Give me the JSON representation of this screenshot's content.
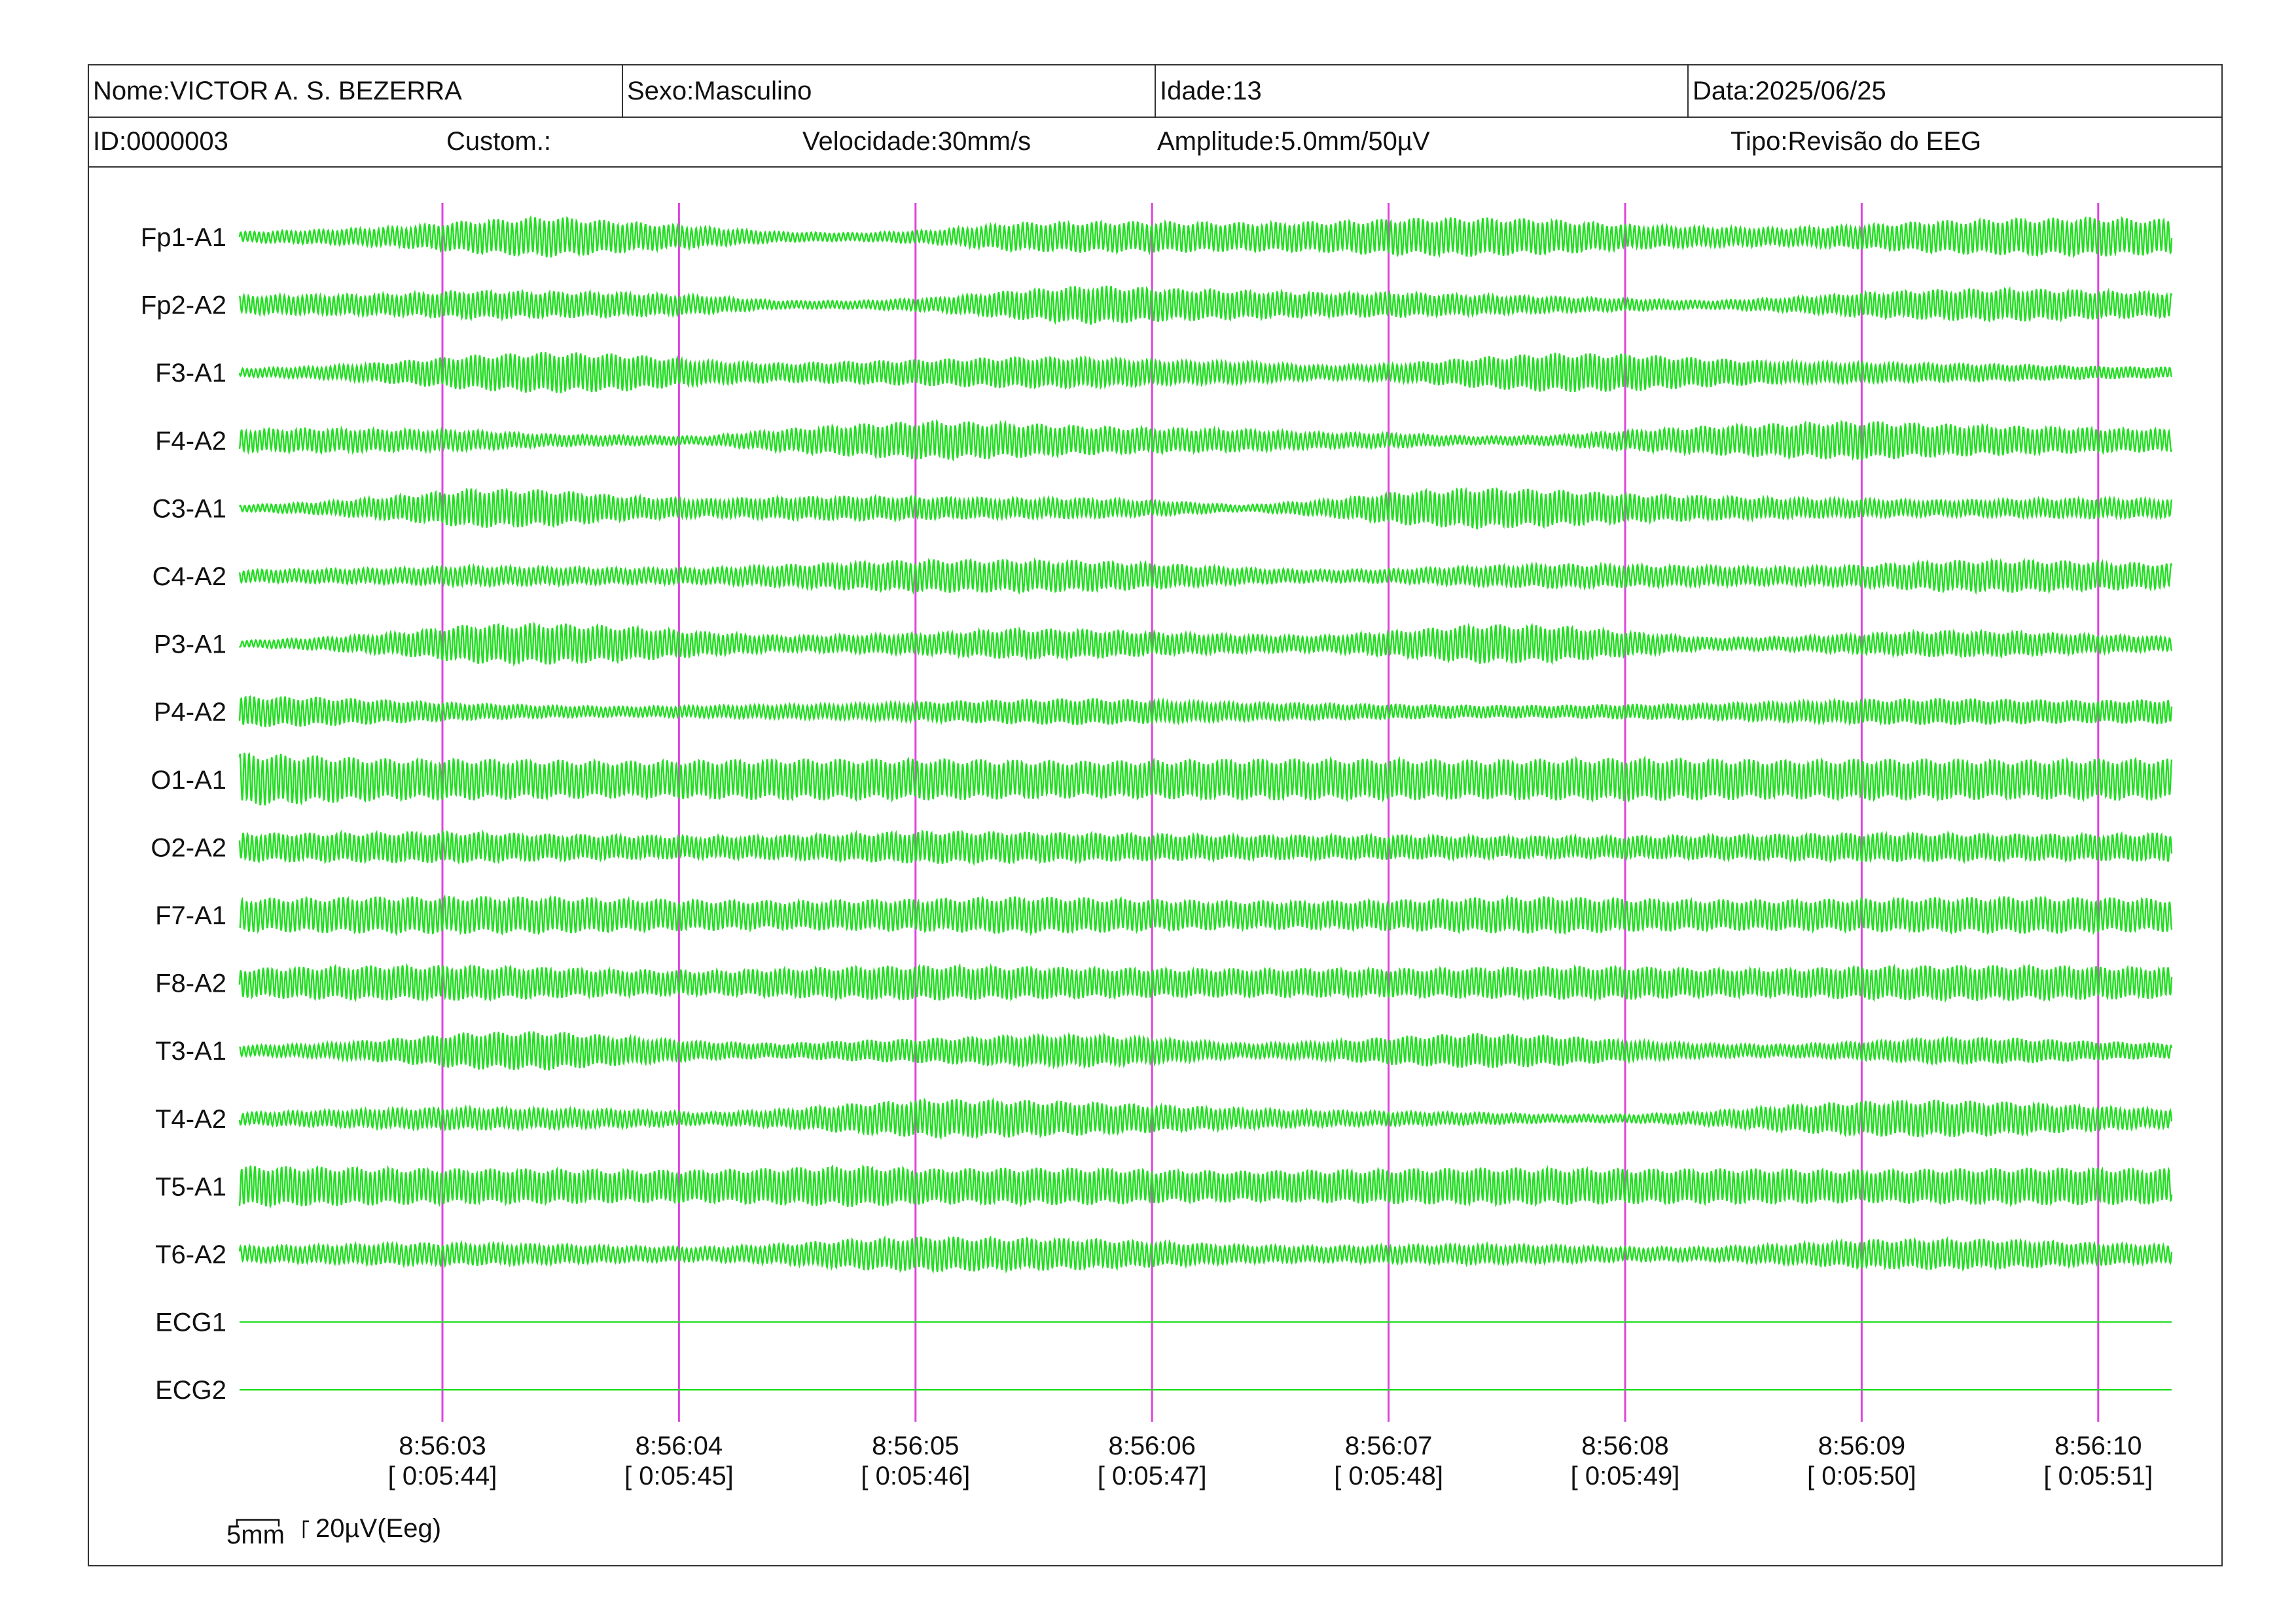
{
  "header": {
    "name": "Nome:VICTOR A. S. BEZERRA",
    "sex": "Sexo:Masculino",
    "age": "Idade:13",
    "date": "Data:2025/06/25",
    "id": "ID:0000003",
    "custom": "Custom.:",
    "speed": "Velocidade:30mm/s",
    "amplitude": "Amplitude:5.0mm/50µV",
    "type": "Tipo:Revisão do EEG"
  },
  "colors": {
    "trace": "#22dd22",
    "marker": "#dd44dd",
    "frame": "#333333",
    "text": "#111111"
  },
  "scale_bar": {
    "time_label": "5mm",
    "amp_label": "20µV(Eeg)"
  },
  "chart_data": {
    "type": "line",
    "title": "",
    "xlabel": "",
    "ylabel": "",
    "grid": false,
    "time_markers": [
      {
        "clock": "8:56:03",
        "elapsed": "[ 0:05:44]"
      },
      {
        "clock": "8:56:04",
        "elapsed": "[ 0:05:45]"
      },
      {
        "clock": "8:56:05",
        "elapsed": "[ 0:05:46]"
      },
      {
        "clock": "8:56:06",
        "elapsed": "[ 0:05:47]"
      },
      {
        "clock": "8:56:07",
        "elapsed": "[ 0:05:48]"
      },
      {
        "clock": "8:56:08",
        "elapsed": "[ 0:05:49]"
      },
      {
        "clock": "8:56:09",
        "elapsed": "[ 0:05:50]"
      },
      {
        "clock": "8:56:10",
        "elapsed": "[ 0:05:51]"
      }
    ],
    "series": [
      {
        "name": "Fp1-A1",
        "amplitude": [
          0.25,
          0.35,
          0.5,
          0.8,
          1.0,
          0.75,
          0.5,
          0.25,
          0.2,
          0.35,
          0.7,
          0.75,
          0.75,
          0.7,
          0.75,
          0.9,
          0.95,
          0.85,
          0.6,
          0.5,
          0.45,
          0.6,
          0.8,
          0.9,
          0.95,
          0.85
        ]
      },
      {
        "name": "Fp2-A2",
        "amplitude": [
          0.45,
          0.5,
          0.55,
          0.7,
          0.65,
          0.6,
          0.45,
          0.2,
          0.2,
          0.35,
          0.7,
          0.95,
          0.8,
          0.7,
          0.6,
          0.6,
          0.5,
          0.4,
          0.3,
          0.2,
          0.35,
          0.6,
          0.75,
          0.8,
          0.7,
          0.6
        ]
      },
      {
        "name": "F3-A1",
        "amplitude": [
          0.2,
          0.3,
          0.55,
          0.85,
          1.0,
          0.9,
          0.6,
          0.45,
          0.55,
          0.65,
          0.75,
          0.75,
          0.6,
          0.55,
          0.35,
          0.45,
          0.75,
          0.95,
          0.9,
          0.7,
          0.55,
          0.5,
          0.45,
          0.4,
          0.3,
          0.25
        ]
      },
      {
        "name": "F4-A2",
        "amplitude": [
          0.55,
          0.6,
          0.55,
          0.5,
          0.3,
          0.25,
          0.2,
          0.55,
          0.8,
          0.95,
          0.85,
          0.7,
          0.6,
          0.55,
          0.4,
          0.35,
          0.2,
          0.25,
          0.5,
          0.7,
          0.85,
          0.95,
          0.8,
          0.7,
          0.6,
          0.55
        ]
      },
      {
        "name": "C3-A1",
        "amplitude": [
          0.15,
          0.3,
          0.6,
          0.95,
          0.9,
          0.6,
          0.45,
          0.55,
          0.6,
          0.55,
          0.5,
          0.5,
          0.35,
          0.15,
          0.4,
          0.8,
          1.0,
          0.9,
          0.7,
          0.6,
          0.5,
          0.45,
          0.4,
          0.45,
          0.5,
          0.45
        ]
      },
      {
        "name": "C4-A2",
        "amplitude": [
          0.3,
          0.35,
          0.4,
          0.5,
          0.45,
          0.4,
          0.4,
          0.55,
          0.7,
          0.8,
          0.8,
          0.75,
          0.6,
          0.4,
          0.3,
          0.35,
          0.5,
          0.6,
          0.55,
          0.5,
          0.45,
          0.55,
          0.75,
          0.8,
          0.7,
          0.6
        ]
      },
      {
        "name": "P3-A1",
        "amplitude": [
          0.15,
          0.3,
          0.55,
          0.95,
          1.0,
          0.85,
          0.6,
          0.4,
          0.45,
          0.55,
          0.75,
          0.7,
          0.55,
          0.45,
          0.4,
          0.65,
          0.95,
          0.9,
          0.6,
          0.3,
          0.35,
          0.5,
          0.65,
          0.6,
          0.45,
          0.35
        ]
      },
      {
        "name": "P4-A2",
        "amplitude": [
          0.75,
          0.7,
          0.55,
          0.4,
          0.3,
          0.25,
          0.3,
          0.35,
          0.4,
          0.5,
          0.6,
          0.65,
          0.55,
          0.45,
          0.4,
          0.35,
          0.3,
          0.3,
          0.35,
          0.4,
          0.5,
          0.6,
          0.65,
          0.6,
          0.55,
          0.6
        ]
      },
      {
        "name": "O1-A1",
        "amplitude": [
          1.3,
          1.15,
          1.0,
          1.0,
          0.95,
          0.9,
          0.95,
          1.0,
          1.0,
          1.0,
          0.95,
          0.9,
          0.95,
          1.0,
          1.0,
          1.0,
          0.95,
          1.0,
          1.05,
          1.0,
          0.95,
          1.0,
          1.0,
          0.95,
          1.0,
          1.0
        ]
      },
      {
        "name": "O2-A2",
        "amplitude": [
          0.7,
          0.7,
          0.75,
          0.75,
          0.65,
          0.6,
          0.55,
          0.6,
          0.7,
          0.8,
          0.75,
          0.7,
          0.65,
          0.6,
          0.6,
          0.6,
          0.55,
          0.55,
          0.55,
          0.6,
          0.65,
          0.7,
          0.7,
          0.65,
          0.65,
          0.7
        ]
      },
      {
        "name": "F7-A1",
        "amplitude": [
          0.8,
          0.85,
          0.9,
          0.9,
          0.9,
          0.8,
          0.75,
          0.7,
          0.75,
          0.8,
          0.9,
          0.85,
          0.75,
          0.7,
          0.7,
          0.75,
          0.85,
          0.9,
          0.8,
          0.75,
          0.75,
          0.8,
          0.85,
          0.9,
          0.85,
          0.8
        ]
      },
      {
        "name": "F8-A2",
        "amplitude": [
          0.7,
          0.8,
          0.85,
          0.85,
          0.75,
          0.65,
          0.6,
          0.7,
          0.8,
          0.85,
          0.8,
          0.75,
          0.7,
          0.7,
          0.7,
          0.7,
          0.75,
          0.8,
          0.8,
          0.7,
          0.7,
          0.8,
          0.85,
          0.85,
          0.8,
          0.75
        ]
      },
      {
        "name": "T3-A1",
        "amplitude": [
          0.25,
          0.35,
          0.6,
          0.9,
          0.95,
          0.7,
          0.45,
          0.35,
          0.5,
          0.6,
          0.75,
          0.8,
          0.6,
          0.35,
          0.45,
          0.7,
          0.85,
          0.75,
          0.5,
          0.35,
          0.3,
          0.45,
          0.65,
          0.6,
          0.45,
          0.35
        ]
      },
      {
        "name": "T4-A2",
        "amplitude": [
          0.3,
          0.4,
          0.5,
          0.55,
          0.5,
          0.45,
          0.3,
          0.45,
          0.75,
          0.95,
          0.9,
          0.8,
          0.65,
          0.5,
          0.4,
          0.35,
          0.3,
          0.2,
          0.2,
          0.35,
          0.65,
          0.85,
          0.9,
          0.8,
          0.6,
          0.45
        ]
      },
      {
        "name": "T5-A1",
        "amplitude": [
          1.0,
          0.95,
          0.9,
          0.85,
          0.85,
          0.8,
          0.8,
          0.9,
          1.0,
          0.85,
          0.9,
          0.9,
          0.8,
          0.75,
          0.8,
          0.85,
          0.9,
          0.9,
          0.85,
          0.85,
          0.85,
          0.8,
          0.85,
          0.9,
          0.9,
          0.85
        ]
      },
      {
        "name": "T6-A2",
        "amplitude": [
          0.4,
          0.45,
          0.55,
          0.55,
          0.5,
          0.4,
          0.35,
          0.5,
          0.75,
          0.85,
          0.8,
          0.75,
          0.6,
          0.45,
          0.4,
          0.45,
          0.5,
          0.45,
          0.35,
          0.35,
          0.5,
          0.7,
          0.75,
          0.7,
          0.55,
          0.45
        ]
      },
      {
        "name": "ECG1",
        "amplitude": [
          0
        ]
      },
      {
        "name": "ECG2",
        "amplitude": [
          0
        ]
      }
    ]
  }
}
